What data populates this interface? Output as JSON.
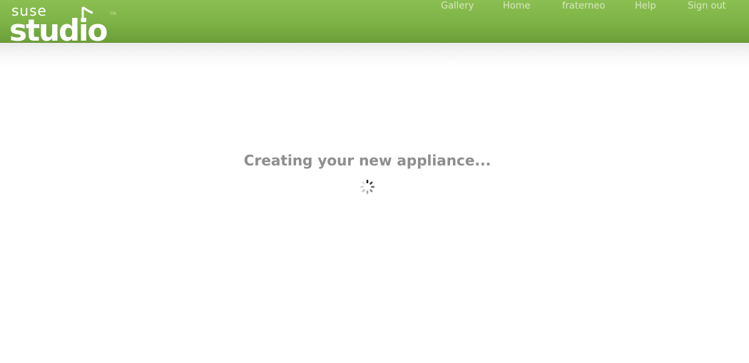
{
  "header": {
    "brand": "suse studio",
    "brand_line1": "suse",
    "brand_line2": "studio",
    "trademark": "TM",
    "nav": [
      {
        "label": "Gallery"
      },
      {
        "label": "Home"
      },
      {
        "label": "fraterneo"
      },
      {
        "label": "Help"
      },
      {
        "label": "Sign out"
      }
    ]
  },
  "main": {
    "status_text": "Creating your new appliance...",
    "spinner_icon": "loading-spinner-icon"
  },
  "colors": {
    "header_green": "#7fb548",
    "nav_text": "#d6e8bd",
    "status_text": "#8e8e8e"
  }
}
